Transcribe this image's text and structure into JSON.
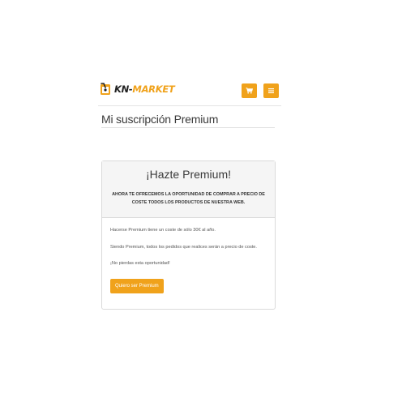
{
  "header": {
    "logo_prefix": "KN-",
    "logo_suffix": "MARKET",
    "cart_icon": "cart-icon",
    "menu_icon": "hamburger-icon"
  },
  "page": {
    "title": "Mi suscripción Premium"
  },
  "panel": {
    "title": "¡Hazte Premium!",
    "subtitle": "AHORA TE OFRECEMOS LA OPORTUNIDAD DE COMPRAR A PRECIO DE COSTE TODOS LOS PRODUCTOS DE NUESTRA WEB.",
    "paragraphs": [
      "Hacerse Premium tiene un coste de sólo 30€ al año.",
      "Siendo Premium, todos los pedidos que realices serán a precio de coste.",
      "¡No pierdas esta oportunidad!"
    ],
    "cta_label": "Quiero ser Premium"
  },
  "colors": {
    "accent": "#f0a21b",
    "border": "#dadada",
    "panel_head_bg": "#f5f5f5"
  }
}
